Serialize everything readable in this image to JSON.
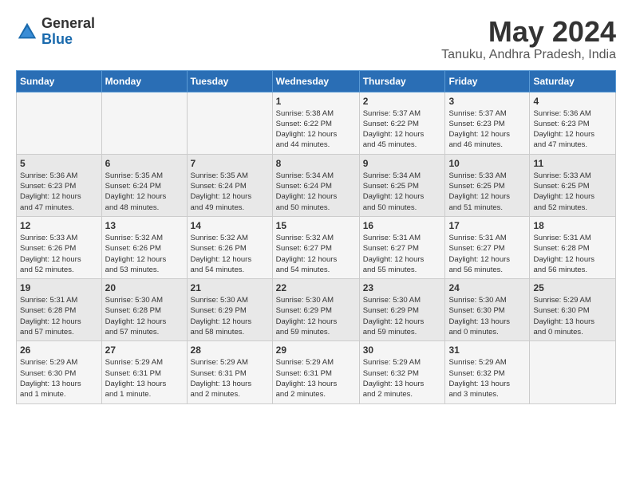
{
  "logo": {
    "general": "General",
    "blue": "Blue"
  },
  "title": {
    "month_year": "May 2024",
    "location": "Tanuku, Andhra Pradesh, India"
  },
  "days_of_week": [
    "Sunday",
    "Monday",
    "Tuesday",
    "Wednesday",
    "Thursday",
    "Friday",
    "Saturday"
  ],
  "weeks": [
    [
      {
        "day": "",
        "info": ""
      },
      {
        "day": "",
        "info": ""
      },
      {
        "day": "",
        "info": ""
      },
      {
        "day": "1",
        "info": "Sunrise: 5:38 AM\nSunset: 6:22 PM\nDaylight: 12 hours\nand 44 minutes."
      },
      {
        "day": "2",
        "info": "Sunrise: 5:37 AM\nSunset: 6:22 PM\nDaylight: 12 hours\nand 45 minutes."
      },
      {
        "day": "3",
        "info": "Sunrise: 5:37 AM\nSunset: 6:23 PM\nDaylight: 12 hours\nand 46 minutes."
      },
      {
        "day": "4",
        "info": "Sunrise: 5:36 AM\nSunset: 6:23 PM\nDaylight: 12 hours\nand 47 minutes."
      }
    ],
    [
      {
        "day": "5",
        "info": "Sunrise: 5:36 AM\nSunset: 6:23 PM\nDaylight: 12 hours\nand 47 minutes."
      },
      {
        "day": "6",
        "info": "Sunrise: 5:35 AM\nSunset: 6:24 PM\nDaylight: 12 hours\nand 48 minutes."
      },
      {
        "day": "7",
        "info": "Sunrise: 5:35 AM\nSunset: 6:24 PM\nDaylight: 12 hours\nand 49 minutes."
      },
      {
        "day": "8",
        "info": "Sunrise: 5:34 AM\nSunset: 6:24 PM\nDaylight: 12 hours\nand 50 minutes."
      },
      {
        "day": "9",
        "info": "Sunrise: 5:34 AM\nSunset: 6:25 PM\nDaylight: 12 hours\nand 50 minutes."
      },
      {
        "day": "10",
        "info": "Sunrise: 5:33 AM\nSunset: 6:25 PM\nDaylight: 12 hours\nand 51 minutes."
      },
      {
        "day": "11",
        "info": "Sunrise: 5:33 AM\nSunset: 6:25 PM\nDaylight: 12 hours\nand 52 minutes."
      }
    ],
    [
      {
        "day": "12",
        "info": "Sunrise: 5:33 AM\nSunset: 6:26 PM\nDaylight: 12 hours\nand 52 minutes."
      },
      {
        "day": "13",
        "info": "Sunrise: 5:32 AM\nSunset: 6:26 PM\nDaylight: 12 hours\nand 53 minutes."
      },
      {
        "day": "14",
        "info": "Sunrise: 5:32 AM\nSunset: 6:26 PM\nDaylight: 12 hours\nand 54 minutes."
      },
      {
        "day": "15",
        "info": "Sunrise: 5:32 AM\nSunset: 6:27 PM\nDaylight: 12 hours\nand 54 minutes."
      },
      {
        "day": "16",
        "info": "Sunrise: 5:31 AM\nSunset: 6:27 PM\nDaylight: 12 hours\nand 55 minutes."
      },
      {
        "day": "17",
        "info": "Sunrise: 5:31 AM\nSunset: 6:27 PM\nDaylight: 12 hours\nand 56 minutes."
      },
      {
        "day": "18",
        "info": "Sunrise: 5:31 AM\nSunset: 6:28 PM\nDaylight: 12 hours\nand 56 minutes."
      }
    ],
    [
      {
        "day": "19",
        "info": "Sunrise: 5:31 AM\nSunset: 6:28 PM\nDaylight: 12 hours\nand 57 minutes."
      },
      {
        "day": "20",
        "info": "Sunrise: 5:30 AM\nSunset: 6:28 PM\nDaylight: 12 hours\nand 57 minutes."
      },
      {
        "day": "21",
        "info": "Sunrise: 5:30 AM\nSunset: 6:29 PM\nDaylight: 12 hours\nand 58 minutes."
      },
      {
        "day": "22",
        "info": "Sunrise: 5:30 AM\nSunset: 6:29 PM\nDaylight: 12 hours\nand 59 minutes."
      },
      {
        "day": "23",
        "info": "Sunrise: 5:30 AM\nSunset: 6:29 PM\nDaylight: 12 hours\nand 59 minutes."
      },
      {
        "day": "24",
        "info": "Sunrise: 5:30 AM\nSunset: 6:30 PM\nDaylight: 13 hours\nand 0 minutes."
      },
      {
        "day": "25",
        "info": "Sunrise: 5:29 AM\nSunset: 6:30 PM\nDaylight: 13 hours\nand 0 minutes."
      }
    ],
    [
      {
        "day": "26",
        "info": "Sunrise: 5:29 AM\nSunset: 6:30 PM\nDaylight: 13 hours\nand 1 minute."
      },
      {
        "day": "27",
        "info": "Sunrise: 5:29 AM\nSunset: 6:31 PM\nDaylight: 13 hours\nand 1 minute."
      },
      {
        "day": "28",
        "info": "Sunrise: 5:29 AM\nSunset: 6:31 PM\nDaylight: 13 hours\nand 2 minutes."
      },
      {
        "day": "29",
        "info": "Sunrise: 5:29 AM\nSunset: 6:31 PM\nDaylight: 13 hours\nand 2 minutes."
      },
      {
        "day": "30",
        "info": "Sunrise: 5:29 AM\nSunset: 6:32 PM\nDaylight: 13 hours\nand 2 minutes."
      },
      {
        "day": "31",
        "info": "Sunrise: 5:29 AM\nSunset: 6:32 PM\nDaylight: 13 hours\nand 3 minutes."
      },
      {
        "day": "",
        "info": ""
      }
    ]
  ]
}
